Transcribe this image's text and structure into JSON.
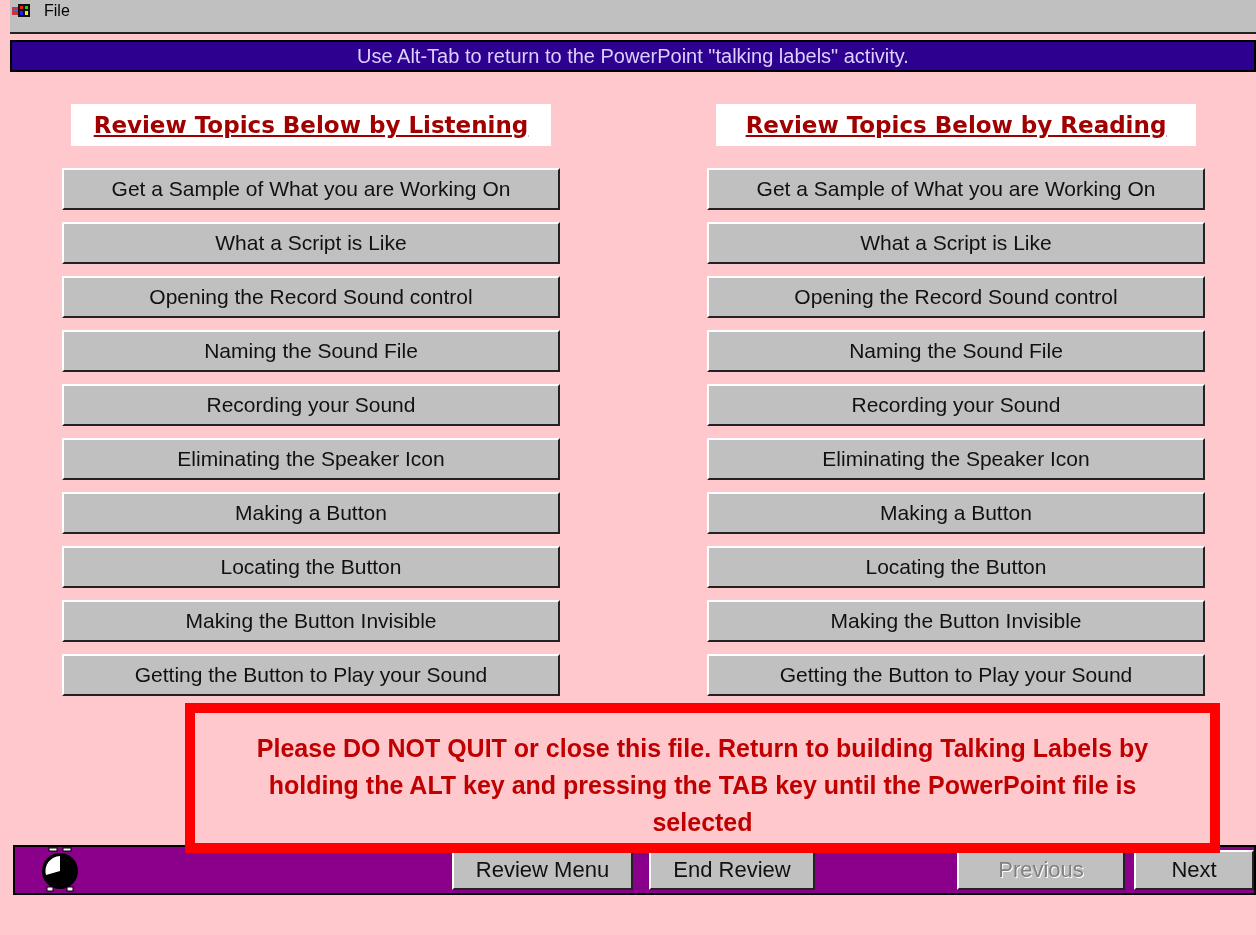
{
  "menu_bar": {
    "items": [
      "File"
    ]
  },
  "banner": "Use Alt-Tab to return to the PowerPoint \"talking labels\" activity.",
  "columns": [
    {
      "heading": "Review Topics Below by Listening",
      "buttons": [
        "Get a Sample of What you are Working On",
        "What a Script is Like",
        "Opening the Record Sound control",
        "Naming the Sound File",
        "Recording your Sound",
        "Eliminating the Speaker Icon",
        "Making a Button",
        "Locating the Button",
        "Making the Button Invisible",
        "Getting the Button to Play your Sound"
      ]
    },
    {
      "heading": "Review Topics Below by Reading",
      "buttons": [
        "Get a Sample of What you are Working On",
        "What a Script is Like",
        "Opening the Record Sound control",
        "Naming the Sound File",
        "Recording your Sound",
        "Eliminating the Speaker Icon",
        "Making a Button",
        "Locating the Button",
        "Making the Button Invisible",
        "Getting the Button to Play your Sound"
      ]
    }
  ],
  "warning": "Please DO NOT QUIT or close this file. Return to building Talking Labels by holding the ALT key and pressing the TAB key until the PowerPoint file is selected",
  "footer": {
    "buttons": [
      {
        "label": "Review Menu",
        "disabled": false
      },
      {
        "label": "End Review",
        "disabled": false
      },
      {
        "label": "Previous",
        "disabled": true
      },
      {
        "label": "Next",
        "disabled": false
      }
    ]
  }
}
